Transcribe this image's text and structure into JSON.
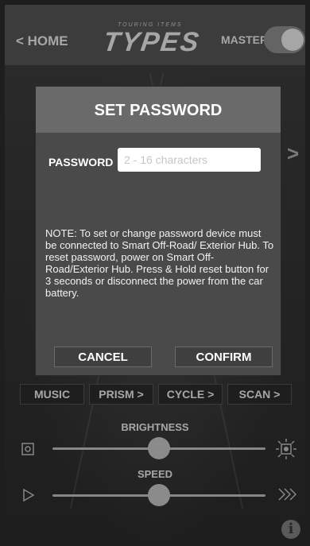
{
  "header": {
    "home_label": "< HOME",
    "logo_tagline": "TOURING ITEMS",
    "logo_text": "TYPES",
    "master_label": "MASTER",
    "master_on": true
  },
  "modes": [
    {
      "label": "MUSIC"
    },
    {
      "label": "PRISM >"
    },
    {
      "label": "CYCLE >"
    },
    {
      "label": "SCAN >"
    }
  ],
  "brightness": {
    "label": "BRIGHTNESS",
    "level": 0.5
  },
  "speed": {
    "label": "SPEED",
    "level": 0.5
  },
  "background_arrow": ">",
  "modal": {
    "title": "SET PASSWORD",
    "password_label": "PASSWORD",
    "password_value": "",
    "password_placeholder": "2 - 16 characters",
    "note": "NOTE: To set or change password device must be connected to Smart Off-Road/ Exterior Hub. To reset password, power on Smart Off-Road/Exterior Hub. Press & Hold reset button for 3 seconds or disconnect the power from the car battery.",
    "cancel_label": "CANCEL",
    "confirm_label": "CONFIRM"
  },
  "info_icon": "i"
}
